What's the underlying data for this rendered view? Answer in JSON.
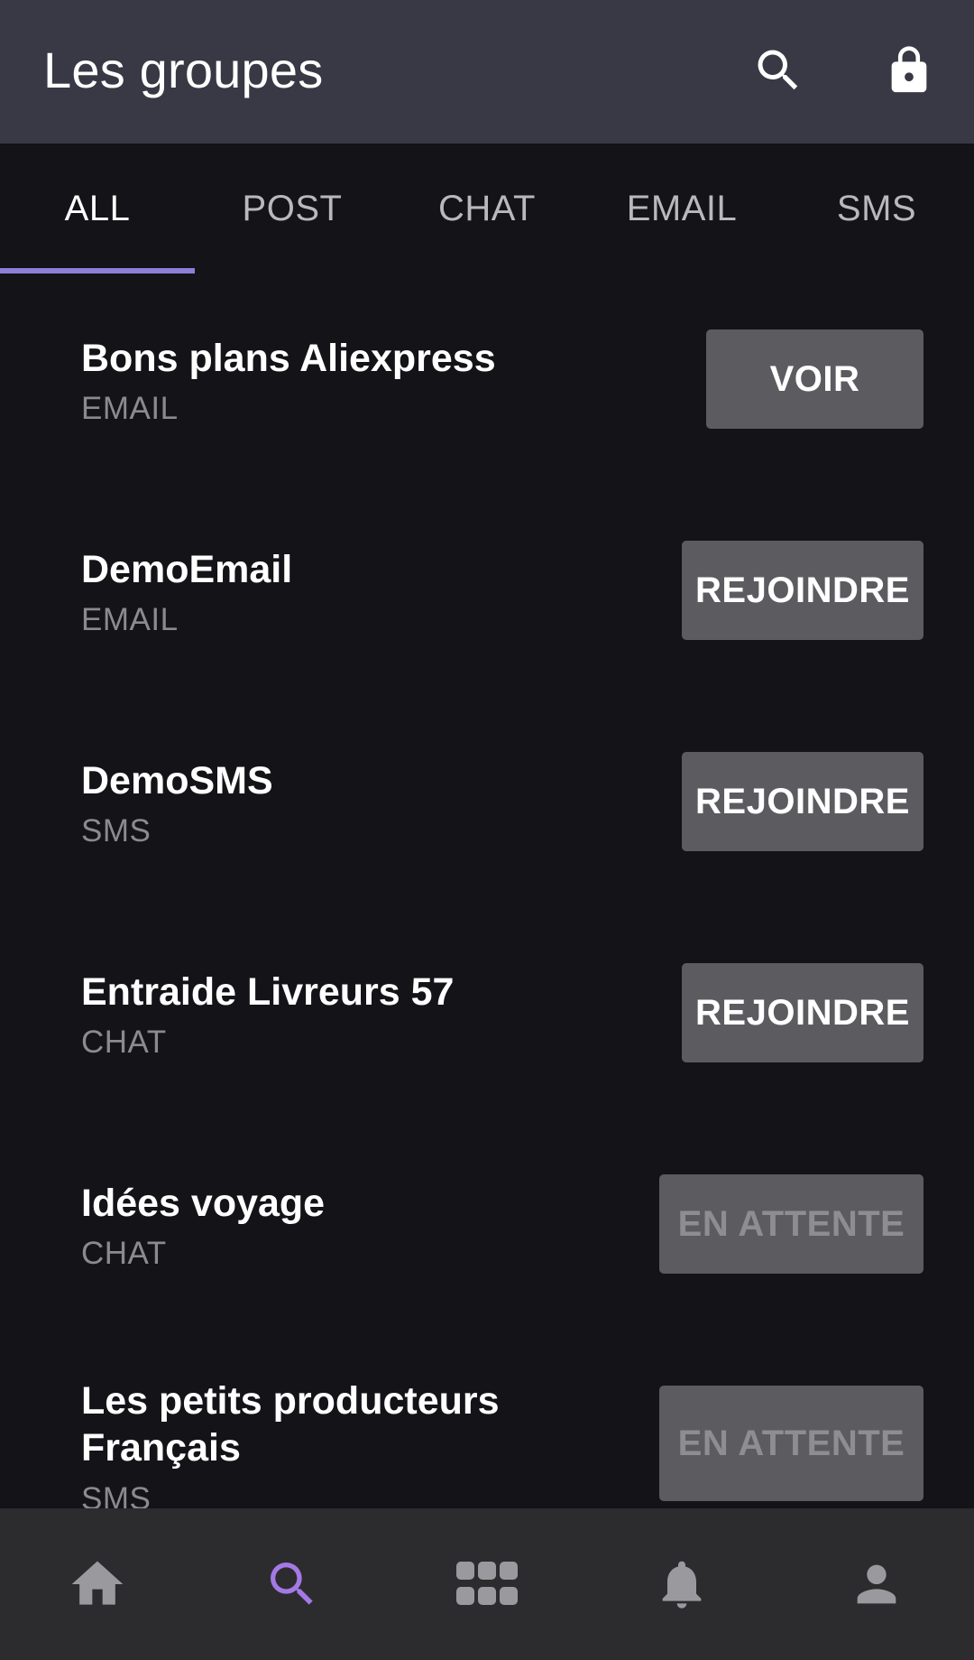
{
  "header": {
    "title": "Les groupes",
    "search_icon": "search-icon",
    "lock_icon": "lock-icon"
  },
  "tabs": [
    {
      "label": "ALL",
      "active": true
    },
    {
      "label": "POST",
      "active": false
    },
    {
      "label": "CHAT",
      "active": false
    },
    {
      "label": "EMAIL",
      "active": false
    },
    {
      "label": "SMS",
      "active": false
    }
  ],
  "groups": [
    {
      "name": "Bons plans Aliexpress",
      "type": "EMAIL",
      "action": "VOIR"
    },
    {
      "name": "DemoEmail",
      "type": "EMAIL",
      "action": "REJOINDRE"
    },
    {
      "name": "DemoSMS",
      "type": "SMS",
      "action": "REJOINDRE"
    },
    {
      "name": "Entraide Livreurs 57",
      "type": "CHAT",
      "action": "REJOINDRE"
    },
    {
      "name": "Idées voyage",
      "type": "CHAT",
      "action": "EN ATTENTE"
    },
    {
      "name": "Les petits producteurs Français",
      "type": "SMS",
      "action": "EN ATTENTE"
    }
  ],
  "bottom_nav": [
    {
      "icon": "home-icon",
      "active": false
    },
    {
      "icon": "search-icon",
      "active": true
    },
    {
      "icon": "apps-grid-icon",
      "active": false
    },
    {
      "icon": "bell-icon",
      "active": false
    },
    {
      "icon": "person-icon",
      "active": false
    }
  ],
  "colors": {
    "header_bg": "#393945",
    "background": "#131318",
    "accent": "#8d7fd9",
    "active_nav": "#a479e6",
    "button_bg": "#5c5c60",
    "nav_bg": "#2c2c2e"
  }
}
